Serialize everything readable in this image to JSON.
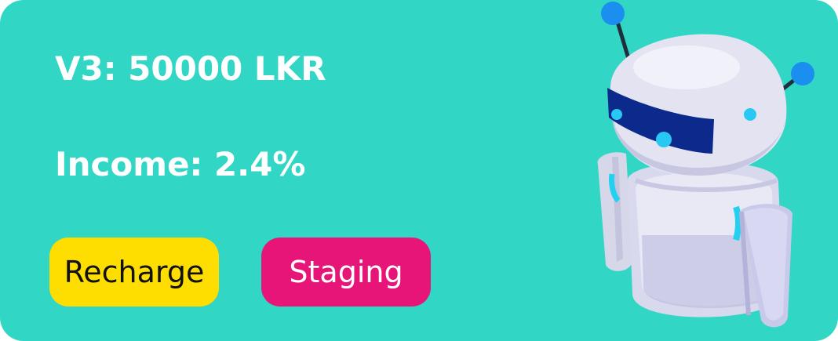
{
  "plan": {
    "title": "V3: 50000 LKR",
    "income": "Income: 2.4%"
  },
  "actions": {
    "recharge_label": "Recharge",
    "staging_label": "Staging"
  },
  "colors": {
    "card_background": "#31d6c4",
    "recharge_button": "#fede00",
    "staging_button": "#e81579",
    "text_primary": "#ffffff"
  },
  "icons": {
    "illustration": "robot-icon"
  }
}
